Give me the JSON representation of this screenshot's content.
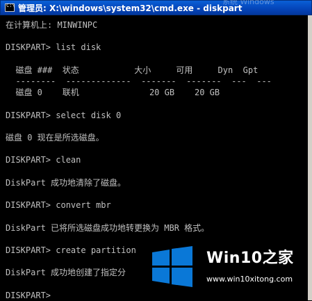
{
  "window": {
    "title": "管理员: X:\\windows\\system32\\cmd.exe - diskpart",
    "ghost_text": "系统 Windows"
  },
  "console": {
    "lines": [
      "在计算机上: MINWINPC",
      "",
      "DISKPART> list disk",
      "",
      "  磁盘 ###  状态           大小     可用     Dyn  Gpt",
      "  --------  -------------  -------  -------  ---  ---",
      "  磁盘 0    联机              20 GB    20 GB",
      "",
      "DISKPART> select disk 0",
      "",
      "磁盘 0 现在是所选磁盘。",
      "",
      "DISKPART> clean",
      "",
      "DiskPart 成功地清除了磁盘。",
      "",
      "DISKPART> convert mbr",
      "",
      "DiskPart 已将所选磁盘成功地转更换为 MBR 格式。",
      "",
      "DISKPART> create partition",
      "",
      "DiskPart 成功地创建了指定分",
      "",
      "DISKPART>"
    ]
  },
  "watermark": {
    "brand": "Win10之家",
    "url": "www.win10xitong.com",
    "color": "#0a78d7"
  }
}
